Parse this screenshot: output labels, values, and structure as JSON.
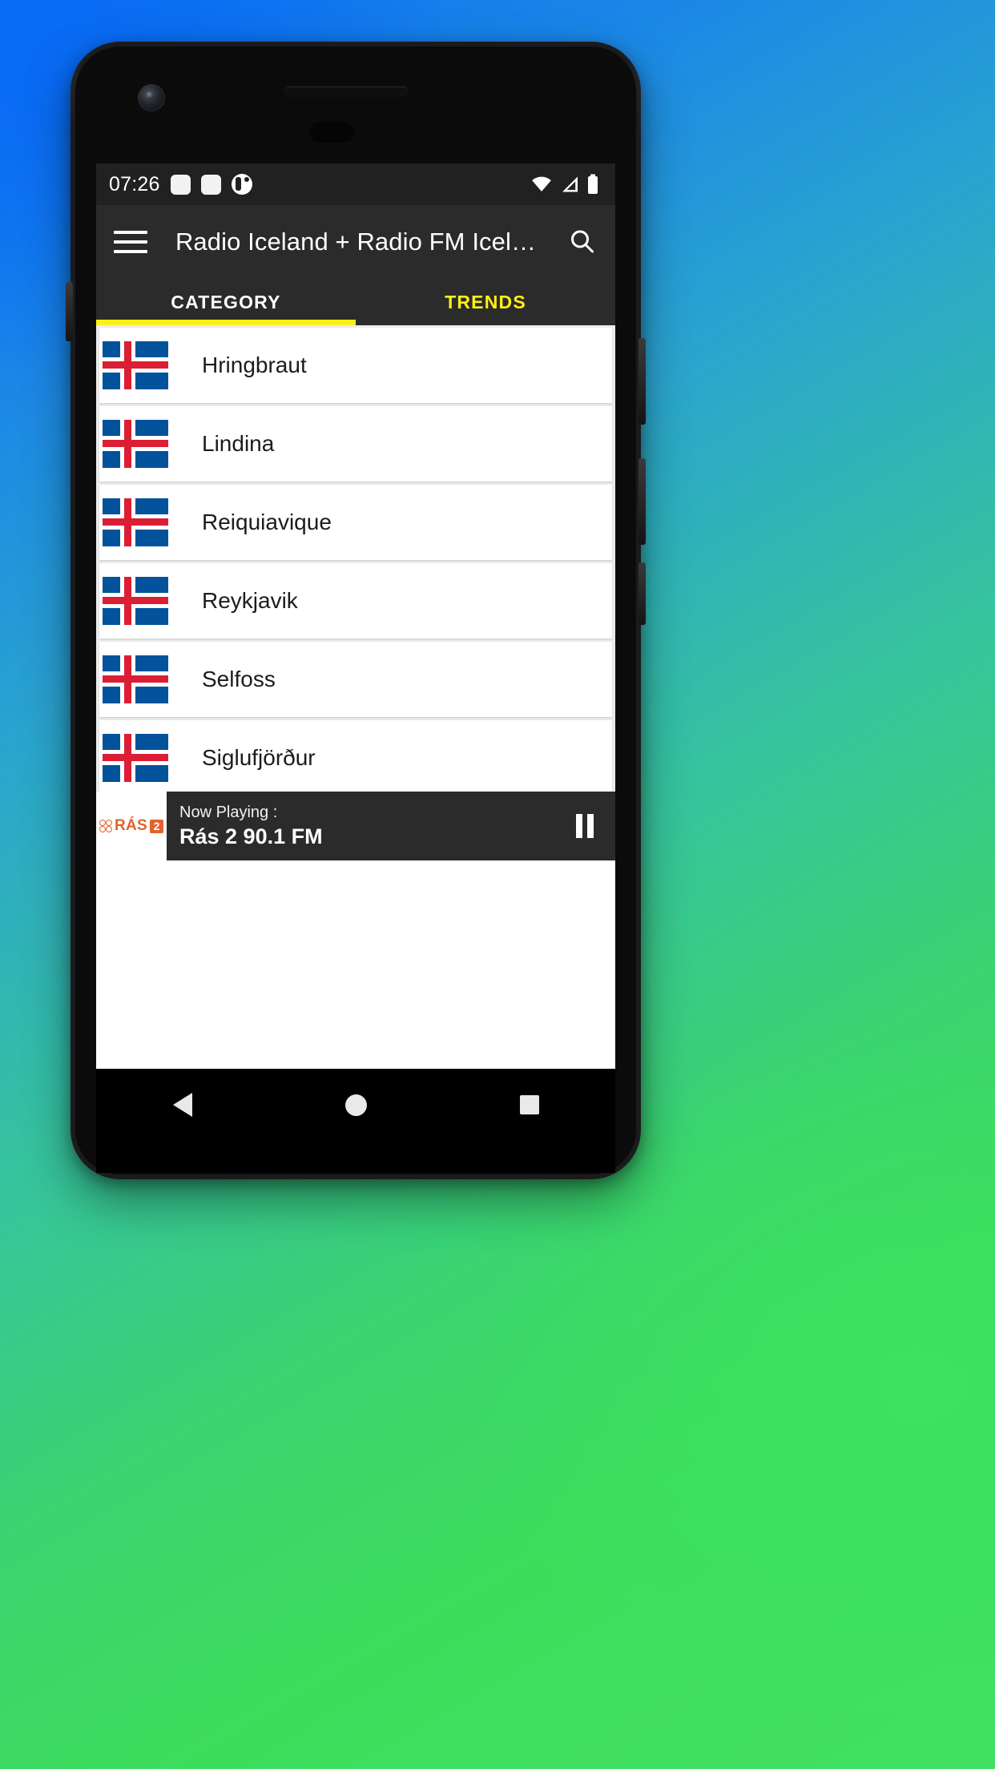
{
  "statusbar": {
    "time": "07:26",
    "icons_left": [
      "app-notification-icon",
      "app-notification-icon",
      "app-notification-icon"
    ],
    "icons_right": [
      "wifi-icon",
      "cell-signal-icon",
      "battery-icon"
    ]
  },
  "appbar": {
    "menu_icon": "hamburger-menu-icon",
    "title": "Radio Iceland + Radio FM Icel…",
    "search_icon": "search-icon"
  },
  "tabs": {
    "items": [
      {
        "label": "CATEGORY",
        "active": true
      },
      {
        "label": "TRENDS",
        "active": false
      }
    ],
    "active_color": "#ffef17",
    "inactive_text_color": "#ffef17",
    "active_text_color": "#ffffff"
  },
  "list": {
    "flag_icon": "iceland-flag-icon",
    "items": [
      {
        "label": "Hringbraut"
      },
      {
        "label": "Lindina"
      },
      {
        "label": "Reiquiavique"
      },
      {
        "label": "Reykjavik"
      },
      {
        "label": "Selfoss"
      },
      {
        "label": "Siglufjörður"
      }
    ]
  },
  "player": {
    "logo_text": "RÁS",
    "logo_badge": "2",
    "logo_color": "#e2622b",
    "now_playing_label": "Now Playing :",
    "now_playing_title": "Rás 2 90.1 FM",
    "control_icon": "pause-icon"
  },
  "navbar": {
    "back": "back-triangle-icon",
    "home": "home-circle-icon",
    "recents": "recents-square-icon"
  }
}
